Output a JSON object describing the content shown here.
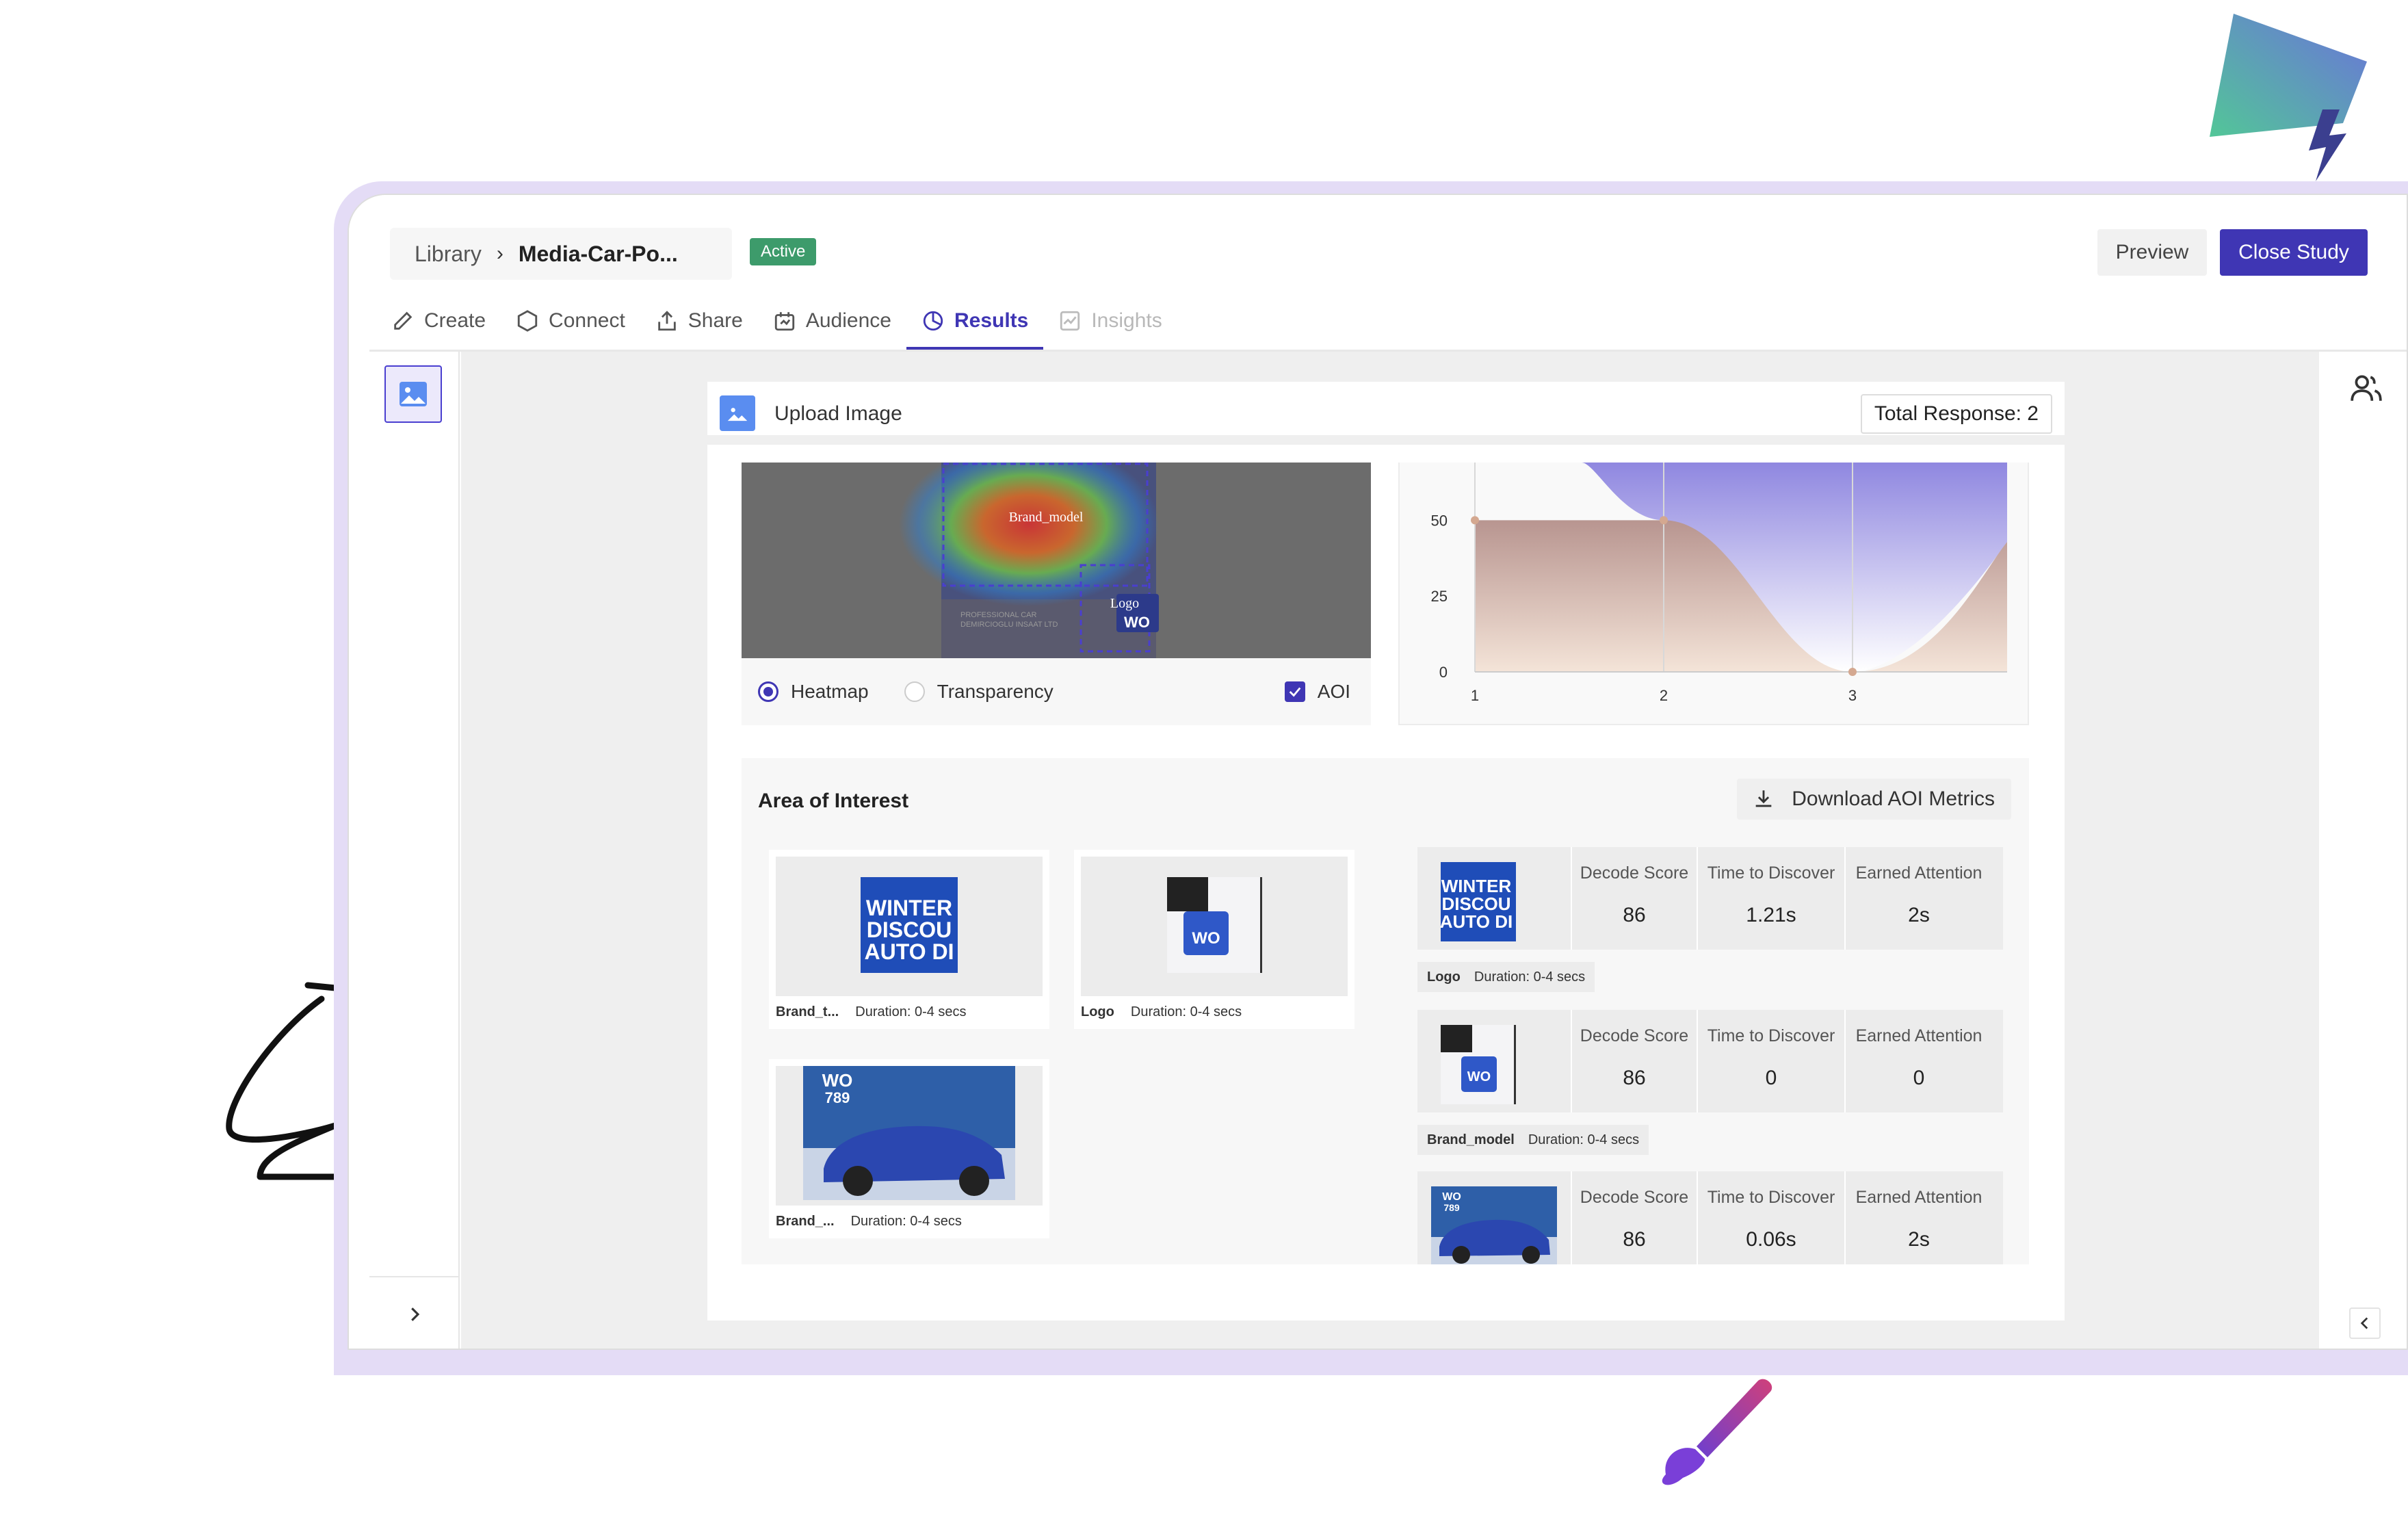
{
  "breadcrumb": {
    "root": "Library",
    "current": "Media-Car-Po..."
  },
  "status": "Active",
  "header": {
    "preview": "Preview",
    "close_study": "Close Study"
  },
  "tabs": [
    {
      "label": "Create"
    },
    {
      "label": "Connect"
    },
    {
      "label": "Share"
    },
    {
      "label": "Audience"
    },
    {
      "label": "Results"
    },
    {
      "label": "Insights"
    }
  ],
  "upload": {
    "label": "Upload Image",
    "total_response": "Total Response: 2"
  },
  "heatmap": {
    "aoi_labels": [
      "Brand_model",
      "Logo",
      "PROFESSIONAL CAR",
      "DEMIRCIOGLU INSAAT LTD",
      "WO"
    ],
    "controls": {
      "heatmap": "Heatmap",
      "transparency": "Transparency",
      "aoi": "AOI"
    }
  },
  "chart_data": {
    "type": "area",
    "x": [
      1,
      2,
      3
    ],
    "series": [
      {
        "values": [
          50,
          50,
          0
        ]
      }
    ],
    "y_ticks": [
      "50",
      "25",
      "0"
    ],
    "x_ticks": [
      "1",
      "2",
      "3"
    ],
    "ylim": [
      0,
      60
    ],
    "grid": true
  },
  "aoi": {
    "title": "Area of Interest",
    "download": "Download AOI Metrics",
    "thumbs": [
      {
        "name": "Brand_t...",
        "duration": "Duration: 0-4 secs",
        "text": [
          "WINTER",
          "DISCOU",
          "AUTO DI"
        ]
      },
      {
        "name": "Logo",
        "duration": "Duration: 0-4 secs",
        "text": [
          "WO"
        ]
      },
      {
        "name": "Brand_...",
        "duration": "Duration: 0-4 secs",
        "text": [
          "WO",
          "789"
        ]
      }
    ],
    "metric_headers": {
      "decode": "Decode Score",
      "discover": "Time to Discover",
      "attention": "Earned Attention"
    },
    "metrics": [
      {
        "caption_name": "",
        "caption_duration": "",
        "thumb_text": [
          "WINTER",
          "DISCOU",
          "AUTO DI"
        ],
        "decode": "86",
        "discover": "1.21s",
        "attention": "2s"
      },
      {
        "caption_name": "Logo",
        "caption_duration": "Duration: 0-4 secs",
        "thumb_text": [
          "WO"
        ],
        "decode": "86",
        "discover": "0",
        "attention": "0"
      },
      {
        "caption_name": "Brand_model",
        "caption_duration": "Duration: 0-4 secs",
        "thumb_text": [
          "WO",
          "789"
        ],
        "decode": "86",
        "discover": "0.06s",
        "attention": "2s"
      }
    ]
  },
  "colors": {
    "primary": "#3f36b4",
    "active_badge": "#3d9b6b",
    "frame": "#e4dcf6"
  }
}
